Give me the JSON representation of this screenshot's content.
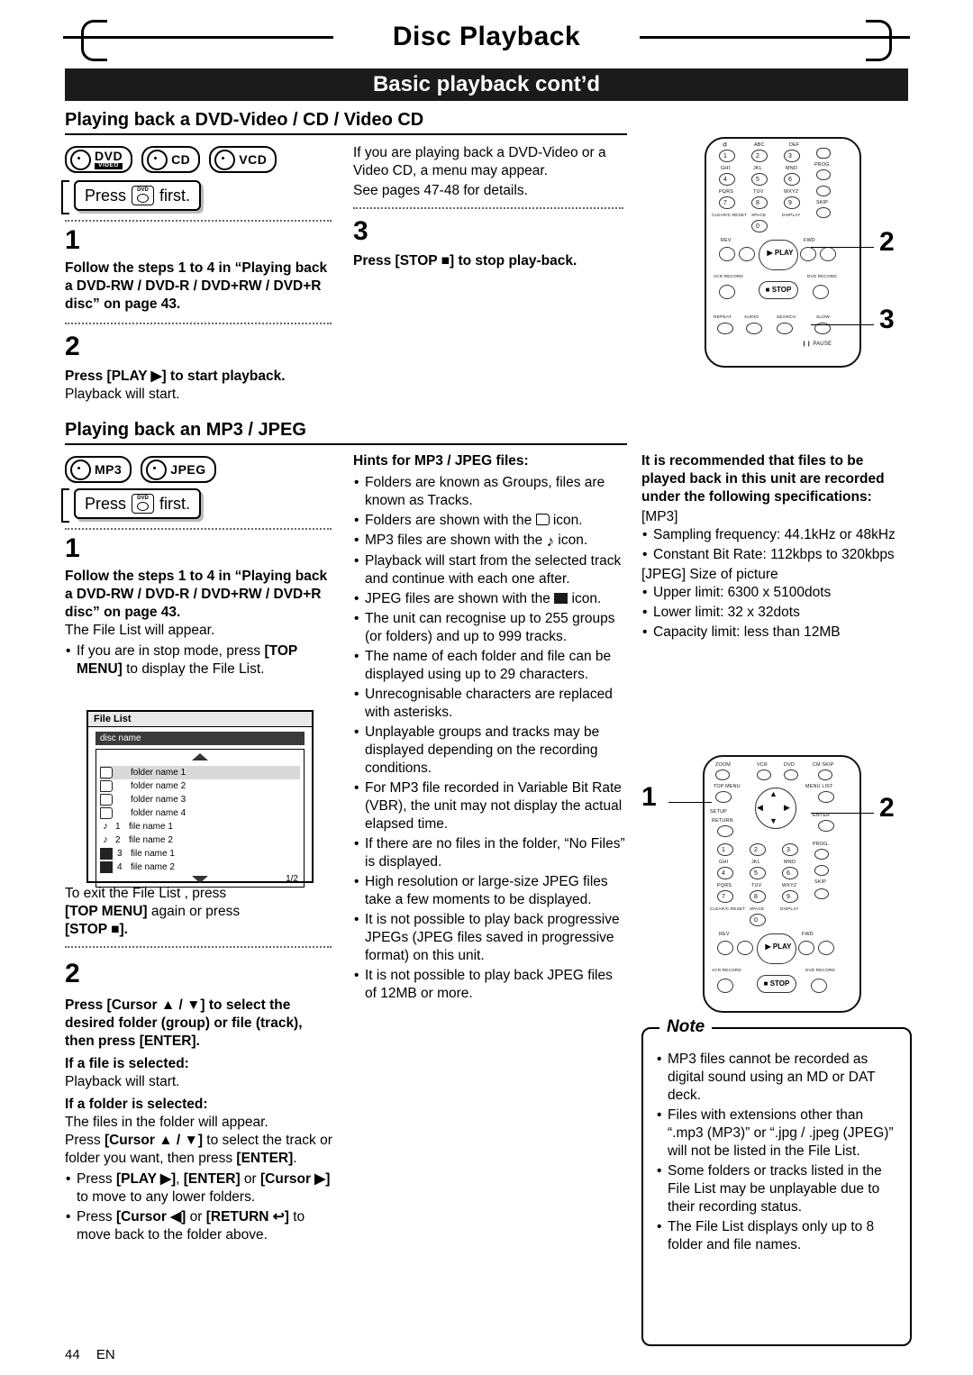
{
  "header": {
    "title": "Disc Playback",
    "banner": "Basic playback cont’d"
  },
  "sections": {
    "dvd_heading": "Playing back a DVD-Video / CD / Video CD",
    "mp3_heading": "Playing back an MP3 / JPEG"
  },
  "media_badges_dvd": [
    {
      "main": "DVD",
      "sub": "VIDEO"
    },
    {
      "main": "CD",
      "sub": ""
    },
    {
      "main": "VCD",
      "sub": ""
    }
  ],
  "media_badges_mp3": [
    {
      "main": "MP3",
      "sub": ""
    },
    {
      "main": "JPEG",
      "sub": ""
    }
  ],
  "press_first": {
    "pre": "Press",
    "key_label": "DVD",
    "post": "first."
  },
  "dvd_col1": {
    "step1_num": "1",
    "step1_text": "Follow the steps 1 to 4 in “Playing back a DVD-RW / DVD-R / DVD+RW / DVD+R disc” on page 43.",
    "step2_num": "2",
    "step2_bold": "Press [PLAY ▶] to start playback.",
    "step2_text": "Playback will start."
  },
  "dvd_col2": {
    "intro": "If you are playing back a DVD-Video or a Video CD, a menu may appear.",
    "intro2": "See pages 47-48 for details.",
    "step3_num": "3",
    "step3_bold": "Press [STOP ■] to stop play-back."
  },
  "mp3_col1": {
    "step1_num": "1",
    "step1_bold": "Follow the steps 1 to 4 in “Playing back a DVD-RW / DVD-R / DVD+RW / DVD+R disc” on page 43.",
    "step1_text": "The File List will appear.",
    "bullet1": "If you are in stop mode, press [TOP MENU] to display the File List.",
    "exit_text": "To exit the File List , press",
    "exit_bold1": "[TOP MENU]",
    "exit_mid": " again or press ",
    "exit_bold2": "[STOP ■].",
    "step2_num": "2",
    "step2_bold": "Press [Cursor ▲ / ▼] to select the desired folder (group) or file (track), then press [ENTER].",
    "sub1_bold": "If a file is selected:",
    "sub1_text": "Playback will start.",
    "sub2_bold": "If a folder is selected:",
    "sub2_text": "The files in the folder will appear.",
    "sub2_text2": "Press [Cursor ▲ / ▼] to select the track or folder you want, then press [ENTER].",
    "bullet2": "Press [PLAY ▶], [ENTER] or [Cursor ▶] to move to any lower folders.",
    "bullet3": "Press [Cursor ◀] or [RETURN ↩] to move back to the folder above."
  },
  "file_list": {
    "title": "File List",
    "disc": "disc name",
    "page": "1/2",
    "rows": [
      {
        "icon": "folder",
        "num": "",
        "label": "folder name 1",
        "selected": true
      },
      {
        "icon": "folder",
        "num": "",
        "label": "folder name 2",
        "selected": false
      },
      {
        "icon": "folder",
        "num": "",
        "label": "folder name 3",
        "selected": false
      },
      {
        "icon": "folder",
        "num": "",
        "label": "folder name 4",
        "selected": false
      },
      {
        "icon": "mp3",
        "num": "1",
        "label": "file name 1",
        "selected": false
      },
      {
        "icon": "mp3",
        "num": "2",
        "label": "file name 2",
        "selected": false
      },
      {
        "icon": "jpeg",
        "num": "3",
        "label": "file name 1",
        "selected": false
      },
      {
        "icon": "jpeg",
        "num": "4",
        "label": "file name 2",
        "selected": false
      }
    ]
  },
  "hints": {
    "heading": "Hints for MP3 / JPEG files:",
    "items": [
      "Folders are known as Groups, files are known as Tracks.",
      "Folders are shown with the @FOLDER icon.",
      "MP3 files are shown with the @MP3 icon.",
      "Playback will start from the selected track and continue with each one after.",
      "JPEG files are shown with the @JPEG icon.",
      "The unit can recognise up to 255 groups (or folders) and up to 999 tracks.",
      "The name of each folder and file can be displayed using up to 29 characters.",
      "Unrecognisable characters are replaced with asterisks.",
      "Unplayable groups and tracks may be displayed depending on the recording conditions.",
      "For MP3 file recorded in Variable Bit Rate (VBR), the unit may not display the actual elapsed time.",
      "If there are no files in the folder, “No Files” is displayed.",
      "High resolution or large-size JPEG files take a few moments to be displayed.",
      "It is not possible to play back progressive JPEGs (JPEG files saved in progressive format) on this unit.",
      "It is not possible to play back JPEG files of 12MB or more."
    ]
  },
  "recommend": {
    "heading": "It is recommended that files to be played back in this unit are recorded under the following specifications:",
    "mp3_label": "[MP3]",
    "mp3_items": [
      "Sampling frequency: 44.1kHz or 48kHz",
      "Constant Bit Rate: 112kbps to 320kbps"
    ],
    "jpeg_label": "[JPEG] Size of picture",
    "jpeg_items": [
      "Upper limit: 6300 x 5100dots",
      "Lower limit: 32 x 32dots",
      "Capacity limit: less than 12MB"
    ]
  },
  "note": {
    "title": "Note",
    "items": [
      "MP3 files cannot be recorded as digital sound using an MD or DAT deck.",
      "Files with extensions other than “.mp3 (MP3)” or “.jpg / .jpeg (JPEG)” will not be listed in the File List.",
      "Some folders or tracks listed in the File List may be unplayable due to their recording status.",
      "The File List displays only up to 8 folder and file names."
    ]
  },
  "callouts": {
    "top_remote": [
      "2",
      "3"
    ],
    "bottom_remote": [
      "1",
      "2"
    ]
  },
  "remote_labels": {
    "row_abc": [
      "ABC",
      "DEF"
    ],
    "row2": [
      "GHI",
      "JKL",
      "MNO"
    ],
    "row3": [
      "PQRS",
      "TUV",
      "WXYZ"
    ],
    "row4": [
      "CLEAR/C.RESET",
      "SPACE",
      "DISPLAY"
    ],
    "nums": [
      "1",
      "2",
      "3",
      "4",
      "5",
      "6",
      "7",
      "8",
      "9",
      "0"
    ],
    "prog": "PROG.",
    "skip": "SKIP",
    "rev": "REV",
    "fwd": "FWD",
    "play": "PLAY",
    "stop": "STOP",
    "vcr_record": "VCR RECORD",
    "dvd_record": "DVD RECORD",
    "repeat": "REPEAT",
    "audio": "AUDIO",
    "search": "SEARCH",
    "slow": "SLOW",
    "pause": "PAUSE",
    "zoom": "ZOOM",
    "vcr": "VCR",
    "dvd": "DVD",
    "cm_skip": "CM SKIP",
    "top_menu": "TOP MENU",
    "menu_list": "MENU LIST",
    "setup": "SETUP",
    "return": "RETURN",
    "enter": "ENTER"
  },
  "footer": {
    "page": "44",
    "lang": "EN"
  }
}
